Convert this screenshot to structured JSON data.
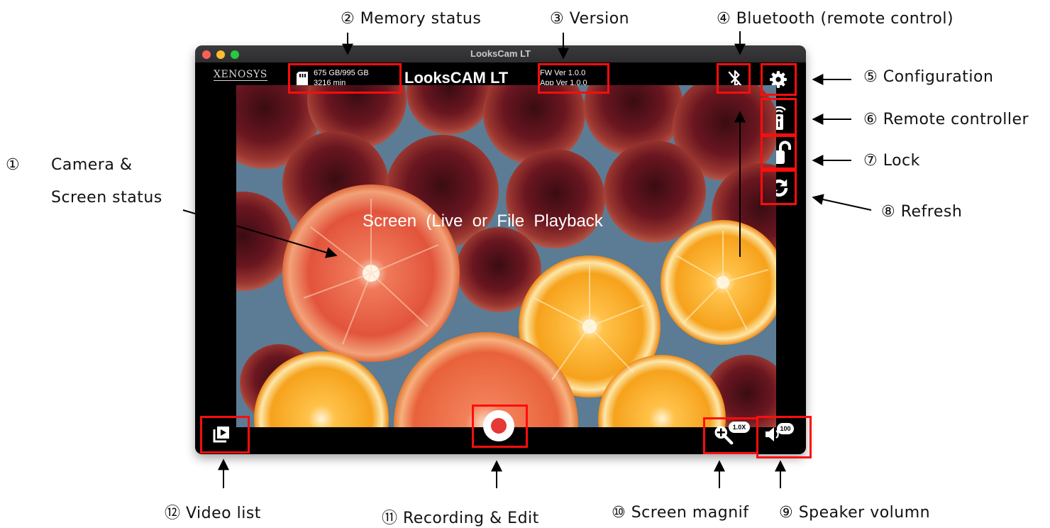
{
  "window": {
    "title": "LooksCam LT"
  },
  "header": {
    "logo_text": "XENOSYS",
    "memory": {
      "capacity": "675 GB/995 GB",
      "remaining": "3216 min"
    },
    "app_title": "LooksCAM LT",
    "version": {
      "fw": "FW Ver 1.0.0",
      "app": "App Ver 1.0.0"
    }
  },
  "screen": {
    "overlay_text": "Screen  (Live  or  File  Playback"
  },
  "controls": {
    "zoom_badge": "1.0X",
    "volume_badge": "100"
  },
  "icons": {
    "memory": "sd-card-icon",
    "bluetooth": "bluetooth-disabled-icon",
    "settings": "gear-icon",
    "remote": "remote-control-icon",
    "lock": "unlock-icon",
    "refresh": "refresh-icon",
    "video_list": "video-list-icon",
    "record": "record-icon",
    "zoom": "zoom-in-icon",
    "volume": "speaker-icon"
  },
  "colors": {
    "highlight": "#ff0d0d",
    "record": "#e53935",
    "traffic": [
      "#ff5f57",
      "#febc2e",
      "#28c840"
    ]
  },
  "annotations": {
    "c1a": "①",
    "c1b": "Camera &",
    "c1c": "Screen status",
    "c2": "②  Memory status",
    "c3": "③  Version",
    "c4": "④  Bluetooth (remote control)",
    "c5": "⑤  Configuration",
    "c6": "⑥  Remote controller",
    "c7": "⑦  Lock",
    "c8": "⑧  Refresh",
    "c9": "⑨  Speaker volumn",
    "c10": "⑩  Screen magnif",
    "c11": "⑪  Recording & Edit",
    "c12": "⑫  Video list"
  }
}
